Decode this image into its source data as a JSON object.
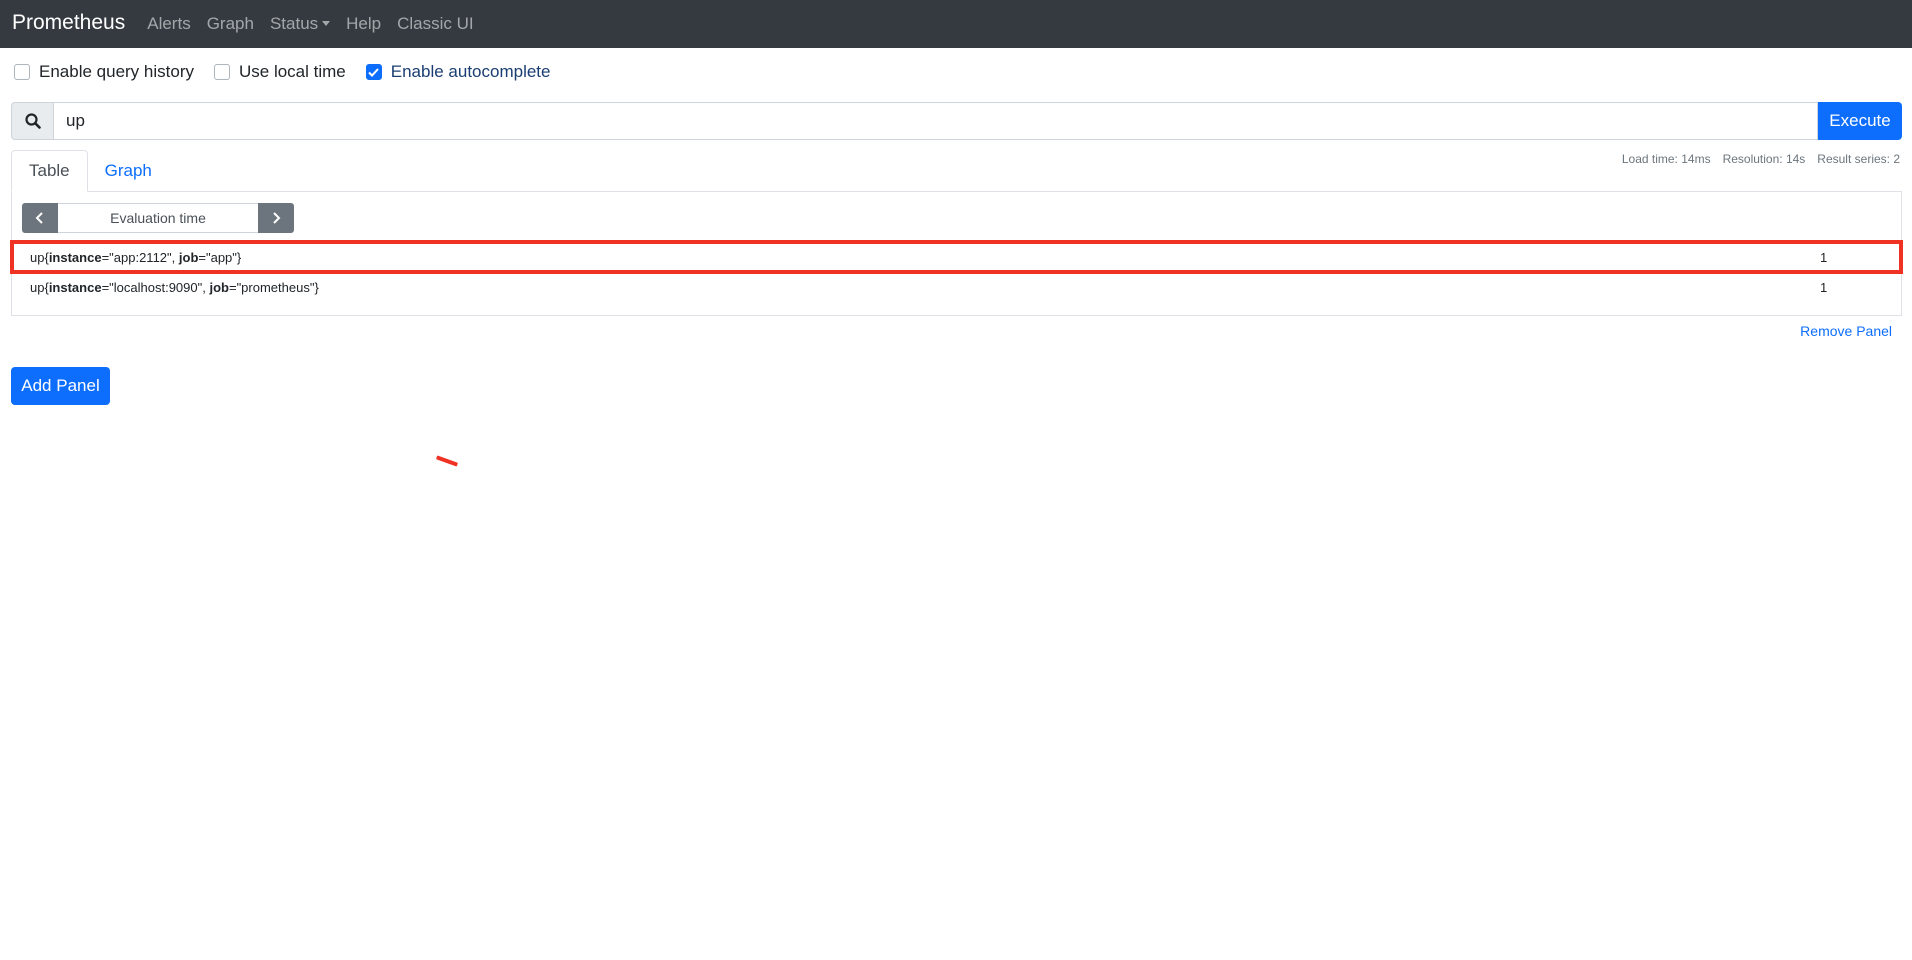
{
  "navbar": {
    "brand": "Prometheus",
    "items": [
      {
        "label": "Alerts"
      },
      {
        "label": "Graph"
      },
      {
        "label": "Status"
      },
      {
        "label": "Help"
      },
      {
        "label": "Classic UI"
      }
    ]
  },
  "options": {
    "query_history": {
      "label": "Enable query history",
      "checked": false
    },
    "local_time": {
      "label": "Use local time",
      "checked": false
    },
    "autocomplete": {
      "label": "Enable autocomplete",
      "checked": true
    }
  },
  "query": {
    "value": "up",
    "execute_label": "Execute"
  },
  "tabs": [
    {
      "label": "Table",
      "active": true
    },
    {
      "label": "Graph",
      "active": false
    }
  ],
  "stats": {
    "load_time": "Load time: 14ms",
    "resolution": "Resolution: 14s",
    "result_series": "Result series: 2"
  },
  "evaluation": {
    "placeholder": "Evaluation time"
  },
  "results": [
    {
      "metric": "up",
      "labels": [
        {
          "name": "instance",
          "value": "\"app:2112\""
        },
        {
          "name": "job",
          "value": "\"app\""
        }
      ],
      "value": "1"
    },
    {
      "metric": "up",
      "labels": [
        {
          "name": "instance",
          "value": "\"localhost:9090\""
        },
        {
          "name": "job",
          "value": "\"prometheus\""
        }
      ],
      "value": "1"
    }
  ],
  "remove_panel_label": "Remove Panel",
  "add_panel_label": "Add Panel",
  "colors": {
    "navbar_bg": "#343a40",
    "primary": "#0d6efd",
    "highlight": "#f03224"
  }
}
